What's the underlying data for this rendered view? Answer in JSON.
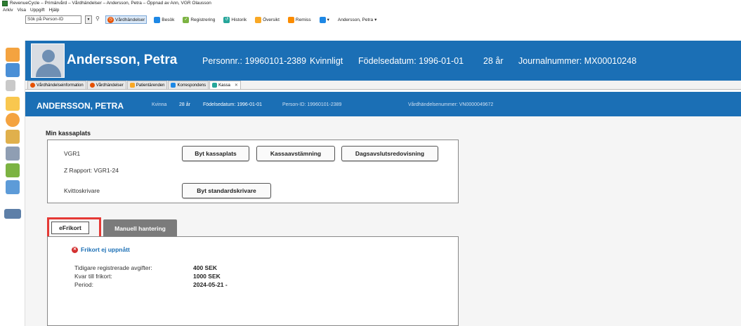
{
  "window": {
    "title": "RevenueCycle – Primärvård – Vårdhändelser – Andersson, Petra – Öppnad av Ann, VGR Olausson"
  },
  "menu": [
    "Arkiv",
    "Visa",
    "Uppgift",
    "Hjälp"
  ],
  "toolbar": {
    "search_placeholder": "Sök på Person-ID",
    "items": [
      {
        "label": "Vårdhändelser",
        "icon": "vardhandelser-icon"
      },
      {
        "label": "Besök",
        "icon": "besok-icon"
      },
      {
        "label": "Registrering",
        "icon": "registrering-icon"
      },
      {
        "label": "Historik",
        "icon": "historik-icon"
      },
      {
        "label": "Översikt",
        "icon": "oversikt-icon"
      },
      {
        "label": "Remiss",
        "icon": "remiss-icon"
      }
    ],
    "patient_dropdown": "Andersson, Petra"
  },
  "header": {
    "name": "Andersson, Petra",
    "personnr": "Personnr.: 19960101-2389",
    "gender": "Kvinnligt",
    "birthdate": "Födelsedatum: 1996-01-01",
    "age": "28 år",
    "journal": "Journalnummer: MX00010248"
  },
  "doc_tabs": [
    {
      "label": "Vårdhändelseinformation",
      "active": false
    },
    {
      "label": "Vårdhändelser",
      "active": false
    },
    {
      "label": "Patientärenden",
      "active": false
    },
    {
      "label": "Korrespondens",
      "active": false
    },
    {
      "label": "Kassa",
      "active": true
    }
  ],
  "band": {
    "name": "ANDERSSON, PETRA",
    "gender": "Kvinna",
    "age": "28 år",
    "birthdate": "Födelsedatum: 1996-01-01",
    "person_id": "Person-ID: 19960101-2389",
    "event_no": "Vårdhändelsenummer: VN0000049672"
  },
  "kassaplats": {
    "title": "Min kassaplats",
    "location": "VGR1",
    "z_report": "Z Rapport: VGR1-24",
    "printer_label": "Kvittoskrivare",
    "buttons": {
      "byt_kassaplats": "Byt kassaplats",
      "kassaavstamning": "Kassaavstämning",
      "dagsavslut": "Dagsavslutsredovisning",
      "byt_skrivare": "Byt standardskrivare"
    }
  },
  "frikort": {
    "tabs": {
      "efrikort": "eFrikort",
      "manuell": "Manuell hantering"
    },
    "status": "Frikort ej uppnått",
    "rows": [
      {
        "label": "Tidigare registrerade avgifter:",
        "value": "400 SEK"
      },
      {
        "label": "Kvar till frikort:",
        "value": "1000 SEK"
      },
      {
        "label": "Period:",
        "value": "2024-05-21 -"
      }
    ]
  },
  "colors": {
    "brand_blue": "#1b6fb5",
    "highlight_red": "#e53935"
  }
}
